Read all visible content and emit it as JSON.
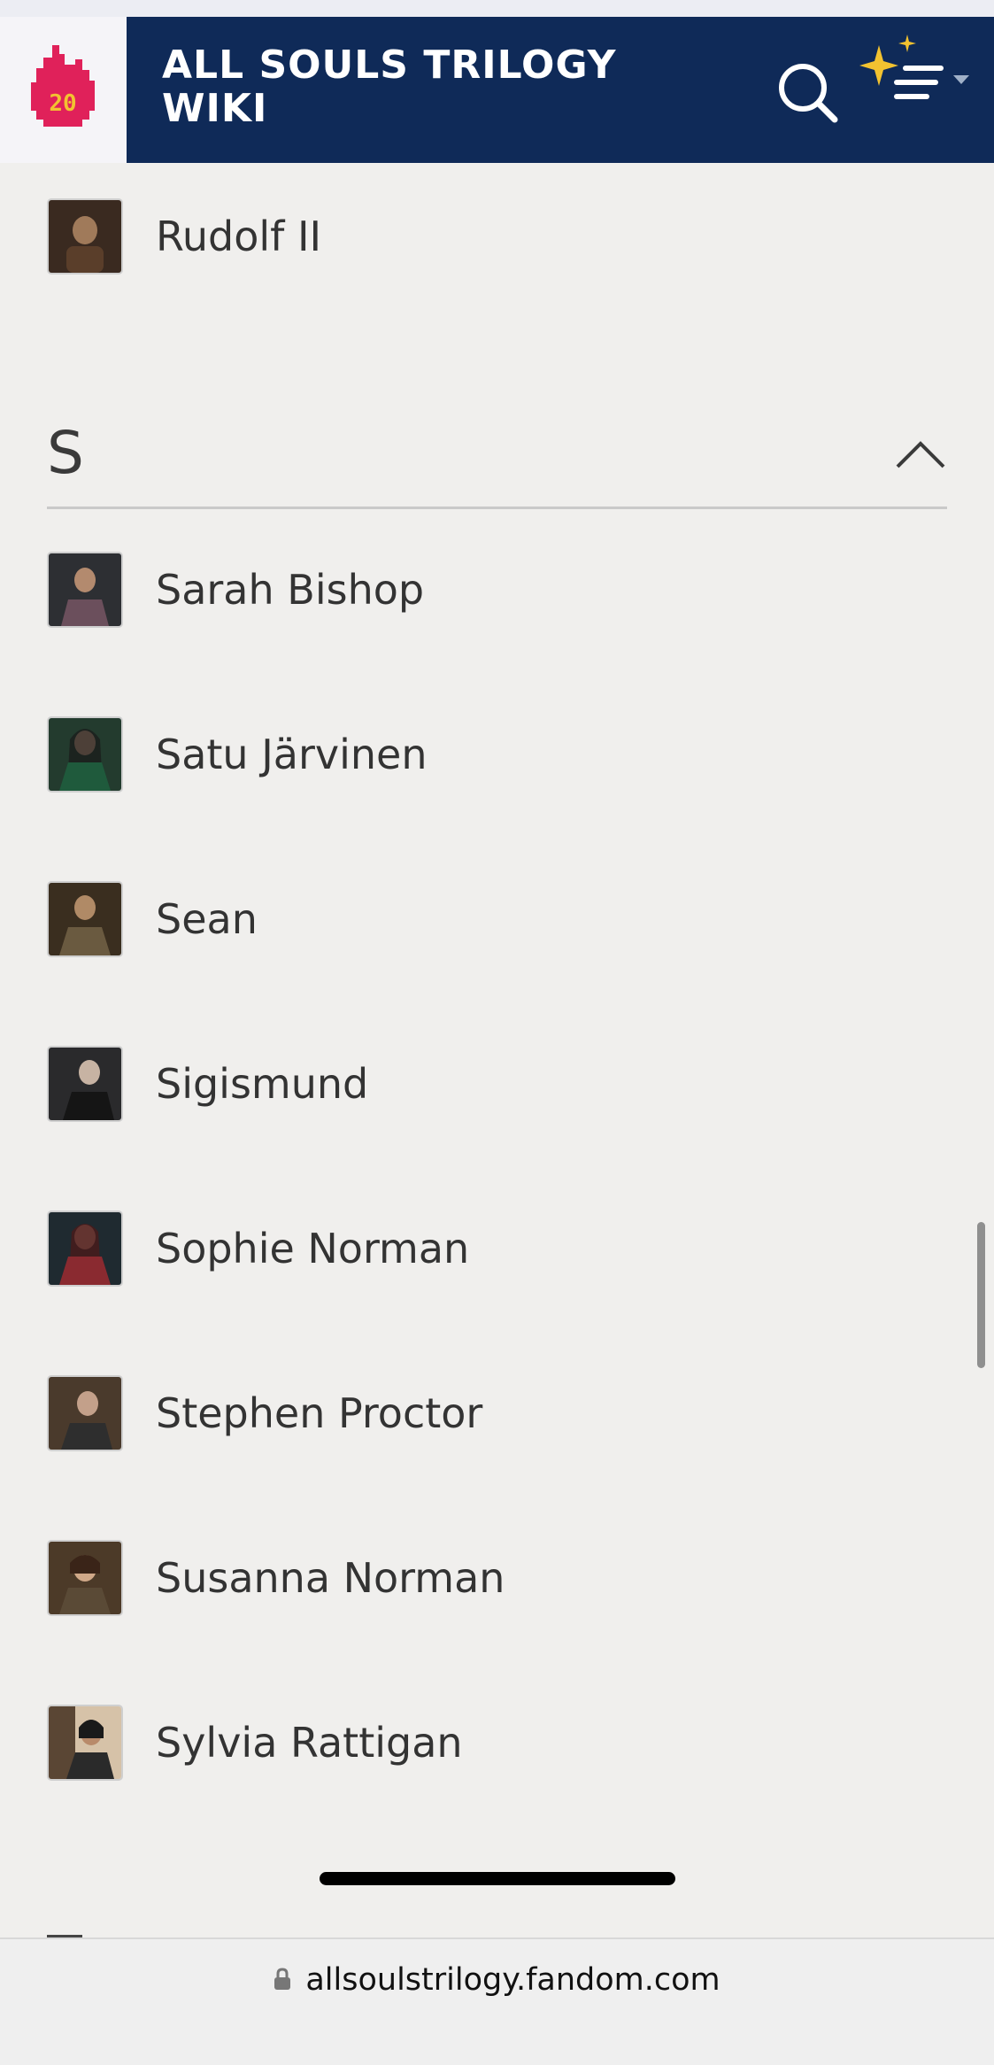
{
  "header": {
    "logo_badge": "20",
    "wiki_title": "ALL SOULS TRILOGY WIKI"
  },
  "above_section": {
    "items": [
      {
        "name": "Rudolf II",
        "thumb_color": "#3a2a20"
      }
    ]
  },
  "section": {
    "letter": "S",
    "items": [
      {
        "name": "Sarah Bishop",
        "thumb_color": "#2d2f33"
      },
      {
        "name": "Satu Järvinen",
        "thumb_color": "#233b2e"
      },
      {
        "name": "Sean",
        "thumb_color": "#3a2e1f"
      },
      {
        "name": "Sigismund",
        "thumb_color": "#2a2a2c"
      },
      {
        "name": "Sophie Norman",
        "thumb_color": "#3a1f24"
      },
      {
        "name": "Stephen Proctor",
        "thumb_color": "#4a3a2c"
      },
      {
        "name": "Susanna Norman",
        "thumb_color": "#4c3a28"
      },
      {
        "name": "Sylvia Rattigan",
        "thumb_color": "#5a4634"
      }
    ]
  },
  "browser": {
    "url": "allsoulstrilogy.fandom.com"
  },
  "colors": {
    "header_bg": "#0f2a58",
    "page_bg": "#f0efed",
    "accent_yellow": "#f2c230",
    "logo_red": "#e0215a"
  }
}
